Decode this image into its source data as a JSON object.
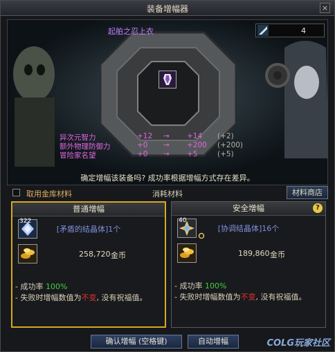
{
  "window": {
    "title": "装备增幅器",
    "close_glyph": "×"
  },
  "item": {
    "name": "起舶之忍上衣",
    "amplify_level": "4"
  },
  "stats": [
    {
      "name": "异次元智力",
      "from": "+12",
      "arrow": "→",
      "to": "+14",
      "diff": "(+2)"
    },
    {
      "name": "额外物理防御力",
      "from": "+0",
      "arrow": "→",
      "to": "+200",
      "diff": "(+200)"
    },
    {
      "name": "冒险家名望",
      "from": "+0",
      "arrow": "→",
      "to": "+5",
      "diff": "(+5)"
    }
  ],
  "confirm_text": "确定增幅该装备吗? 成功率根据增幅方式存在差异。",
  "options": {
    "use_vault_label": "取用金库材料",
    "consume_label": "消耗材料",
    "shop_button": "材料商店"
  },
  "normal": {
    "title": "普通增幅",
    "material_count": "322",
    "material": "[矛盾的结晶体]1个",
    "gold": "258,720",
    "gold_unit": "金币",
    "rate_label": "成功率",
    "rate": "100%",
    "fail_prefix": "失败时增幅数值为",
    "fail_red": "不变",
    "fail_suffix": ", 没有祝福值。"
  },
  "safe": {
    "title": "安全增幅",
    "material_count": "40",
    "material": "[协调结晶体]16个",
    "gold": "189,860",
    "gold_unit": "金币",
    "rate_label": "成功率",
    "rate": "100%",
    "fail_prefix": "失败时增幅数值为",
    "fail_red": "不变",
    "fail_suffix": ", 没有祝福值。",
    "help_glyph": "?"
  },
  "buttons": {
    "confirm": "确认增幅 (空格键)",
    "auto": "自动增幅"
  },
  "watermark": "COLG玩家社区",
  "colors": {
    "selected_border": "#d8a820",
    "stat_purple": "#e067e0",
    "rate_green": "#40d040",
    "warning_red": "#e03030"
  }
}
